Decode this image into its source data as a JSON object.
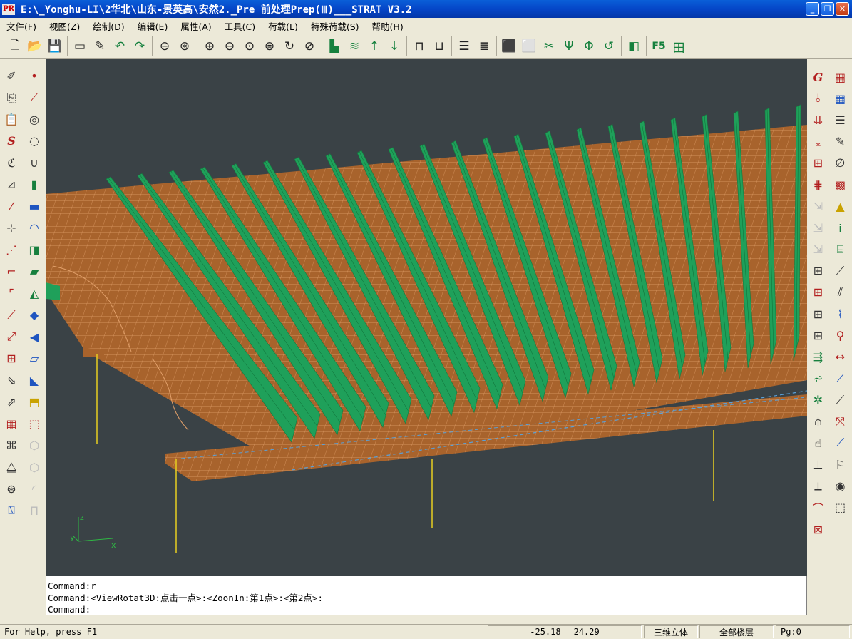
{
  "window": {
    "app_icon": "PR",
    "title": "E:\\_Yonghu-LI\\2华北\\山东-景英高\\安然2._Pre    前处理Prep(Ⅲ)___STRAT V3.2",
    "minimize_icon": "minimize-icon",
    "restore_icon": "restore-icon",
    "close_icon": "close-icon"
  },
  "menu": [
    {
      "label": "文件(F)"
    },
    {
      "label": "视图(Z)"
    },
    {
      "label": "绘制(D)"
    },
    {
      "label": "编辑(E)"
    },
    {
      "label": "属性(A)"
    },
    {
      "label": "工具(C)"
    },
    {
      "label": "荷载(L)"
    },
    {
      "label": "特殊荷载(S)"
    },
    {
      "label": "帮助(H)"
    }
  ],
  "toolbar": {
    "f5_label": "F5"
  },
  "viewport": {
    "axes": {
      "x": "x",
      "y": "y",
      "z": "z"
    },
    "colors": {
      "background": "#3a4246",
      "slab": "#a8632c",
      "mesh": "#e2a06a",
      "wall": "#1fa05a",
      "column": "#e8d020",
      "dashed_edge": "#5aa0d8"
    }
  },
  "command": {
    "lines": [
      "Command:r",
      "Command:<ViewRotat3D:点击一点>:<ZoonIn:第1点>:<第2点>:",
      "Command:"
    ]
  },
  "status": {
    "help": "For Help, press F1",
    "coord_x": "-25.18",
    "coord_y": "24.29",
    "view_mode": "三维立体",
    "floor": "全部楼层",
    "page": "Pg:0"
  }
}
